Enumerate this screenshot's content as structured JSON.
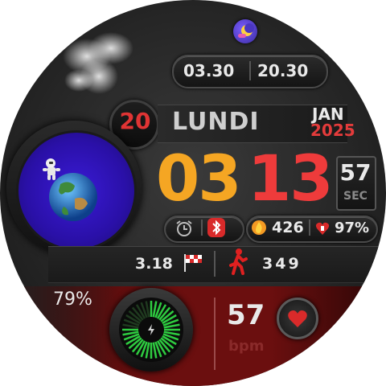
{
  "colors": {
    "hour": "#f5a623",
    "minute": "#ee3b3b",
    "day_number": "#e03434",
    "year": "#e33b3b",
    "bpm_label": "#7a2020",
    "panel_red": "#6b0f0f",
    "gauge_green": "#2ecc40"
  },
  "icons": {
    "top": "weather-night-icon",
    "cloud": "cloud-icon",
    "alarm": "alarm-clock-icon",
    "bluetooth": "bluetooth-icon",
    "calories": "flame-icon",
    "battery": "heart-battery-icon",
    "distance": "checkered-flag-icon",
    "steps": "walking-man-icon",
    "heart": "heart-icon",
    "charge": "lightning-icon",
    "planet": "earth-astronaut-icon"
  },
  "world_times": [
    "03.30",
    "20.30"
  ],
  "date": {
    "day": "20",
    "weekday": "LUNDI",
    "month": "JAN",
    "year": "2025"
  },
  "time": {
    "hour": "03",
    "minute": "13",
    "seconds": "57",
    "seconds_label": "SEC"
  },
  "stats": {
    "calories": "426",
    "battery": "97%",
    "distance": "3.18",
    "steps": "349"
  },
  "gauge": {
    "percent_label": "79%",
    "level": 0.79
  },
  "heart": {
    "bpm": "57",
    "unit": "bpm"
  }
}
